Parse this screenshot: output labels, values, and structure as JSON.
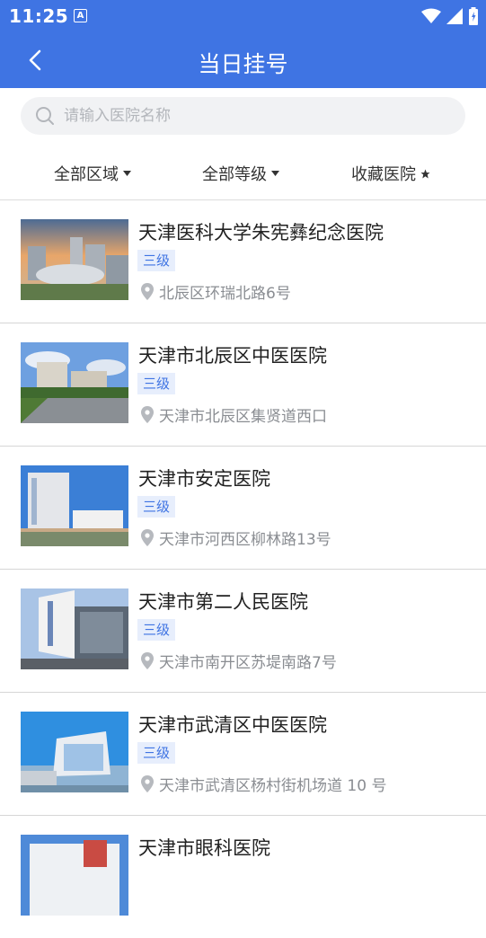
{
  "status_bar": {
    "time": "11:25",
    "notification_badge": "A"
  },
  "header": {
    "title": "当日挂号"
  },
  "search": {
    "placeholder": "请输入医院名称"
  },
  "filters": [
    {
      "label": "全部区域",
      "icon": "triangle-down-icon"
    },
    {
      "label": "全部等级",
      "icon": "triangle-down-icon"
    },
    {
      "label": "收藏医院",
      "icon": "star-icon"
    }
  ],
  "hospitals": [
    {
      "name": "天津医科大学朱宪彝纪念医院",
      "level": "三级",
      "address": "北辰区环瑞北路6号"
    },
    {
      "name": "天津市北辰区中医医院",
      "level": "三级",
      "address": "天津市北辰区集贤道西口"
    },
    {
      "name": "天津市安定医院",
      "level": "三级",
      "address": "天津市河西区柳林路13号"
    },
    {
      "name": "天津市第二人民医院",
      "level": "三级",
      "address": "天津市南开区苏堤南路7号"
    },
    {
      "name": "天津市武清区中医医院",
      "level": "三级",
      "address": "天津市武清区杨村街机场道 10 号"
    },
    {
      "name": "天津市眼科医院",
      "level": "",
      "address": ""
    }
  ],
  "colors": {
    "primary": "#3f74e3",
    "tag_bg": "#e7eefc"
  }
}
